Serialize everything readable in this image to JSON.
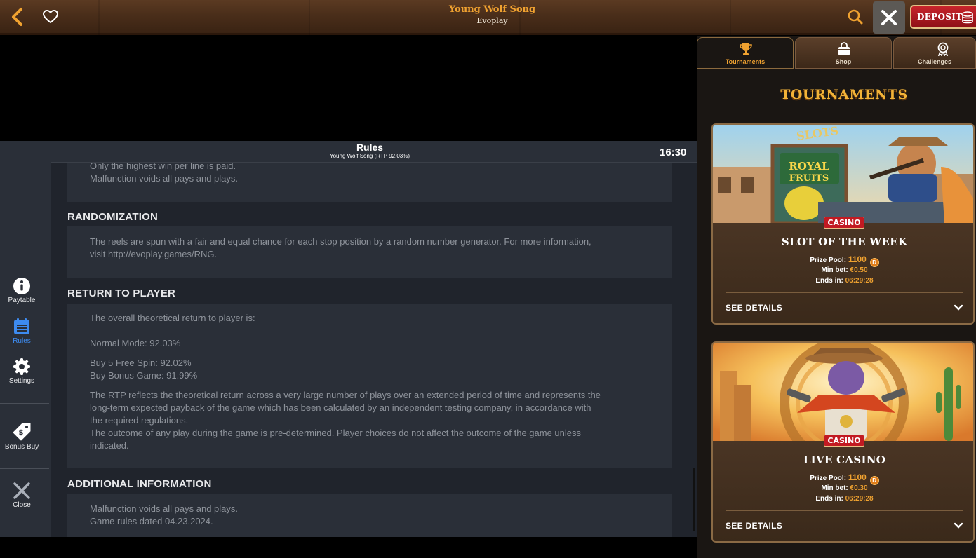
{
  "topbar": {
    "game_title": "Young Wolf Song",
    "provider": "Evoplay",
    "deposit_label": "DEPOSIT"
  },
  "rules": {
    "title": "Rules",
    "subtitle": "Young Wolf Song (RTP 92.03%)",
    "time": "16:30",
    "top_box": {
      "lines": [
        "Only the highest win per line is paid.",
        "Malfunction voids all pays and plays."
      ]
    },
    "randomization": {
      "heading": "RANDOMIZATION",
      "lines": [
        "The reels are spun with a fair and equal chance for each stop position by a random number generator. For more information,",
        "visit http://evoplay.games/RNG."
      ]
    },
    "rtp": {
      "heading": "RETURN TO PLAYER",
      "intro": "The overall theoretical return to player is:",
      "normal": "Normal Mode: 92.03%",
      "buy_free": "Buy 5 Free Spin: 92.02%",
      "buy_bonus": "Buy Bonus Game: 91.99%",
      "para1": [
        "The RTP reflects the theoretical return across a very large number of plays over an extended period of time and represents the",
        "long-term expected payback of the game which has been calculated by an independent testing company, in accordance with",
        "the required regulations."
      ],
      "para2": [
        "The outcome of any play during the game is pre-determined. Player choices do not affect the outcome of the game unless",
        "indicated."
      ]
    },
    "additional": {
      "heading": "ADDITIONAL INFORMATION",
      "lines": [
        "Malfunction voids all pays and plays.",
        "Game rules dated 04.23.2024."
      ]
    }
  },
  "left_nav": {
    "items": [
      {
        "label": "Paytable",
        "icon": "info-icon"
      },
      {
        "label": "Rules",
        "icon": "rules-icon",
        "active": true
      },
      {
        "label": "Settings",
        "icon": "gear-icon"
      },
      {
        "label": "Bonus Buy",
        "icon": "price-tag-icon"
      },
      {
        "label": "Close",
        "icon": "close-icon"
      }
    ],
    "active_color": "#3d8bf0"
  },
  "right_panel": {
    "tabs": [
      {
        "label": "Tournaments",
        "icon": "trophy-icon",
        "active": true
      },
      {
        "label": "Shop",
        "icon": "shopping-bag-icon"
      },
      {
        "label": "Challenges",
        "icon": "medal-icon"
      }
    ],
    "title": "TOURNAMENTS",
    "cards": [
      {
        "badge": "CASINO",
        "title": "SLOT OF THE WEEK",
        "prize_label": "Prize Pool:",
        "prize_value": "1100",
        "min_bet_label": "Min bet:",
        "min_bet_value": "€0.50",
        "ends_label": "Ends in:",
        "ends_value": "06:29:28",
        "details": "SEE DETAILS"
      },
      {
        "badge": "CASINO",
        "title": "LIVE CASINO",
        "prize_label": "Prize Pool:",
        "prize_value": "1100",
        "min_bet_label": "Min bet:",
        "min_bet_value": "€0.30",
        "ends_label": "Ends in:",
        "ends_value": "06:29:28",
        "details": "SEE DETAILS"
      }
    ],
    "coin_glyph": "D"
  },
  "colors": {
    "accent_orange": "#f0a230",
    "deposit_red": "#c7242b",
    "rules_bg": "#20242c",
    "rules_box": "#2a2f38"
  }
}
